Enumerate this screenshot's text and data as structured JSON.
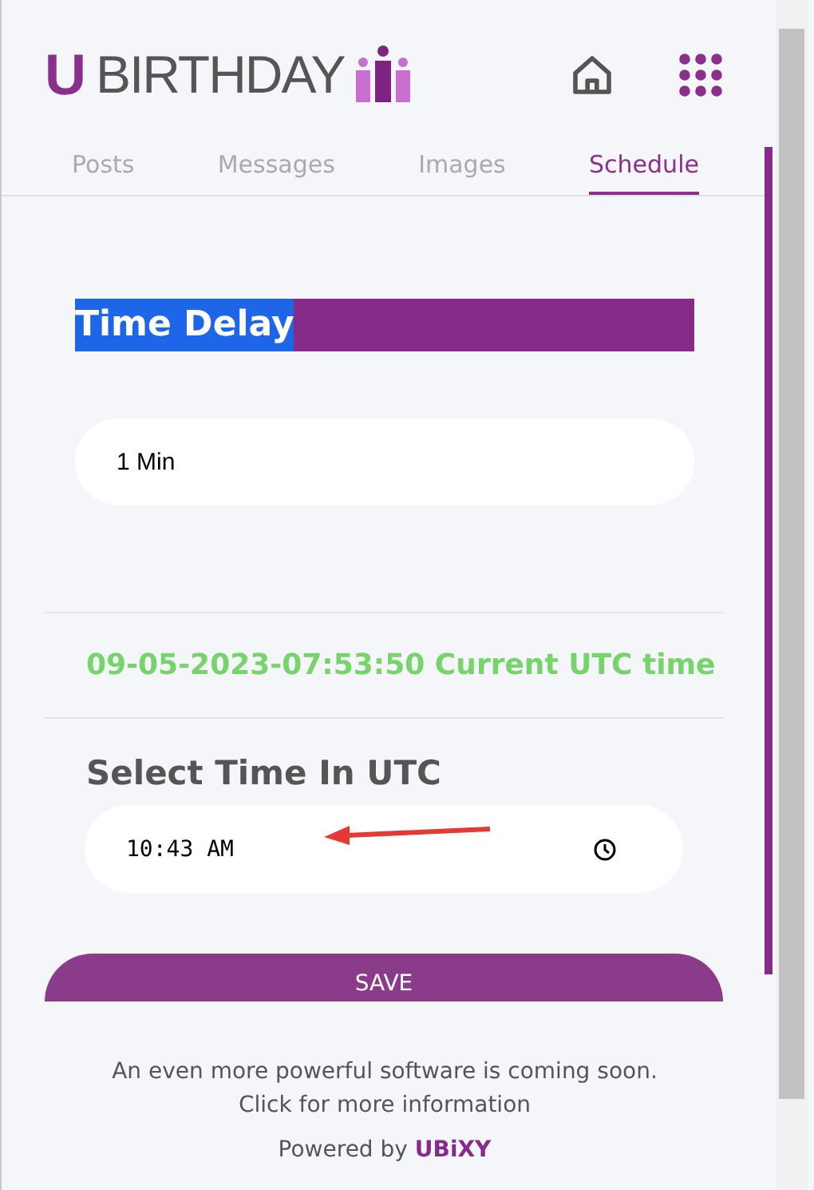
{
  "header": {
    "logo_letter": "U",
    "logo_text": "BIRTHDAY"
  },
  "tabs": [
    {
      "label": "Posts",
      "selected": false
    },
    {
      "label": "Messages",
      "selected": false
    },
    {
      "label": "Images",
      "selected": false
    },
    {
      "label": "Schedule",
      "selected": true
    }
  ],
  "section_heading": {
    "text": "Time Delay",
    "highlighted": true
  },
  "delay_field": {
    "value": "1 Min"
  },
  "current_time": "09-05-2023-07:53:50 Current UTC time",
  "time_label": "Select Time In UTC",
  "time_field": {
    "value": "10:43 AM"
  },
  "save_button": "SAVE",
  "footer": {
    "notice": "An even more powerful software is coming soon.",
    "link": "Click for more information",
    "powered_by": "Powered by",
    "brand": "UBiXY"
  }
}
